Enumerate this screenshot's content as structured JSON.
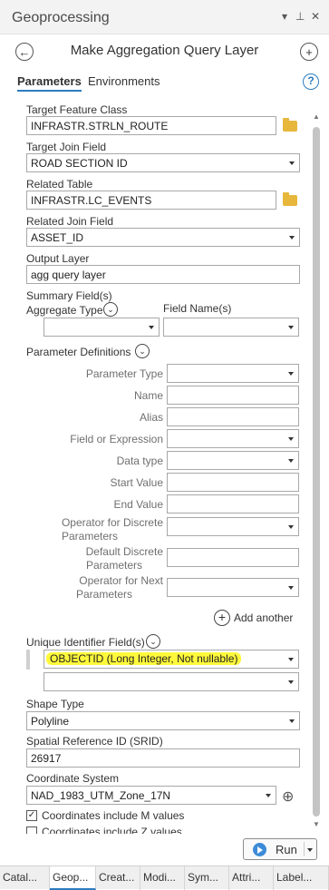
{
  "window": {
    "title": "Geoprocessing",
    "menu_icon": "▾",
    "pin_icon": "⊥",
    "close_icon": "✕"
  },
  "tool": {
    "title": "Make Aggregation Query Layer"
  },
  "tabs": {
    "parameters": "Parameters",
    "environments": "Environments",
    "help": "?"
  },
  "params": {
    "target_feature_class": {
      "label": "Target Feature Class",
      "value": "INFRASTR.STRLN_ROUTE"
    },
    "target_join_field": {
      "label": "Target Join Field",
      "value": "ROAD SECTION ID"
    },
    "related_table": {
      "label": "Related Table",
      "value": "INFRASTR.LC_EVENTS"
    },
    "related_join_field": {
      "label": "Related Join Field",
      "value": "ASSET_ID"
    },
    "output_layer": {
      "label": "Output Layer",
      "value": "agg query layer"
    },
    "summary_fields": {
      "label": "Summary Field(s)",
      "aggregate_type": "Aggregate Type",
      "field_name": "Field Name(s)"
    },
    "parameter_definitions": {
      "label": "Parameter Definitions",
      "parameter_type": "Parameter Type",
      "name": "Name",
      "alias": "Alias",
      "field_or_expression": "Field or Expression",
      "data_type": "Data type",
      "start_value": "Start Value",
      "end_value": "End Value",
      "operator_discrete_1": "Operator for Discrete",
      "operator_discrete_2": "Parameters",
      "default_discrete_1": "Default Discrete",
      "default_discrete_2": "Parameters",
      "operator_next_1": "Operator for Next",
      "operator_next_2": "Parameters",
      "add_another": "Add another"
    },
    "unique_identifier": {
      "label": "Unique Identifier Field(s)",
      "value": "OBJECTID (Long Integer, Not nullable)"
    },
    "shape_type": {
      "label": "Shape Type",
      "value": "Polyline"
    },
    "srid": {
      "label": "Spatial Reference ID (SRID)",
      "value": "26917"
    },
    "coordinate_system": {
      "label": "Coordinate System",
      "value": "NAD_1983_UTM_Zone_17N"
    },
    "coords_m": {
      "label": "Coordinates include M values",
      "checked": true
    },
    "coords_z": {
      "label": "Coordinates include Z values",
      "checked": false
    }
  },
  "run": {
    "label": "Run"
  },
  "bottom_tabs": [
    "Catal...",
    "Geop...",
    "Creat...",
    "Modi...",
    "Sym...",
    "Attri...",
    "Label..."
  ],
  "colors": {
    "accent": "#2c7cbf",
    "highlight": "#fff93b",
    "folder": "#e7b73c",
    "run_icon": "#3d8bd8"
  }
}
